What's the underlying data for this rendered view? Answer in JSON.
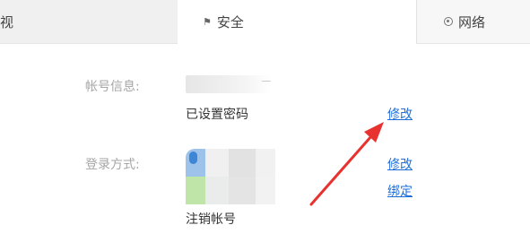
{
  "tabs": {
    "general_label": "视",
    "security_label": "安全",
    "network_label": "网络"
  },
  "account": {
    "label": "帐号信息:",
    "password_status": "已设置密码",
    "modify_link": "修改"
  },
  "login": {
    "label": "登录方式:",
    "modify_link": "修改",
    "bind_link": "绑定",
    "deregister_link": "注销帐号"
  },
  "colors": {
    "link": "#1e6fd9",
    "arrow": "#e8322f",
    "label": "#a6a6a6"
  },
  "icons": {
    "security_tab": "shield-icon",
    "network_tab": "globe-icon",
    "annotation": "red-arrow"
  }
}
